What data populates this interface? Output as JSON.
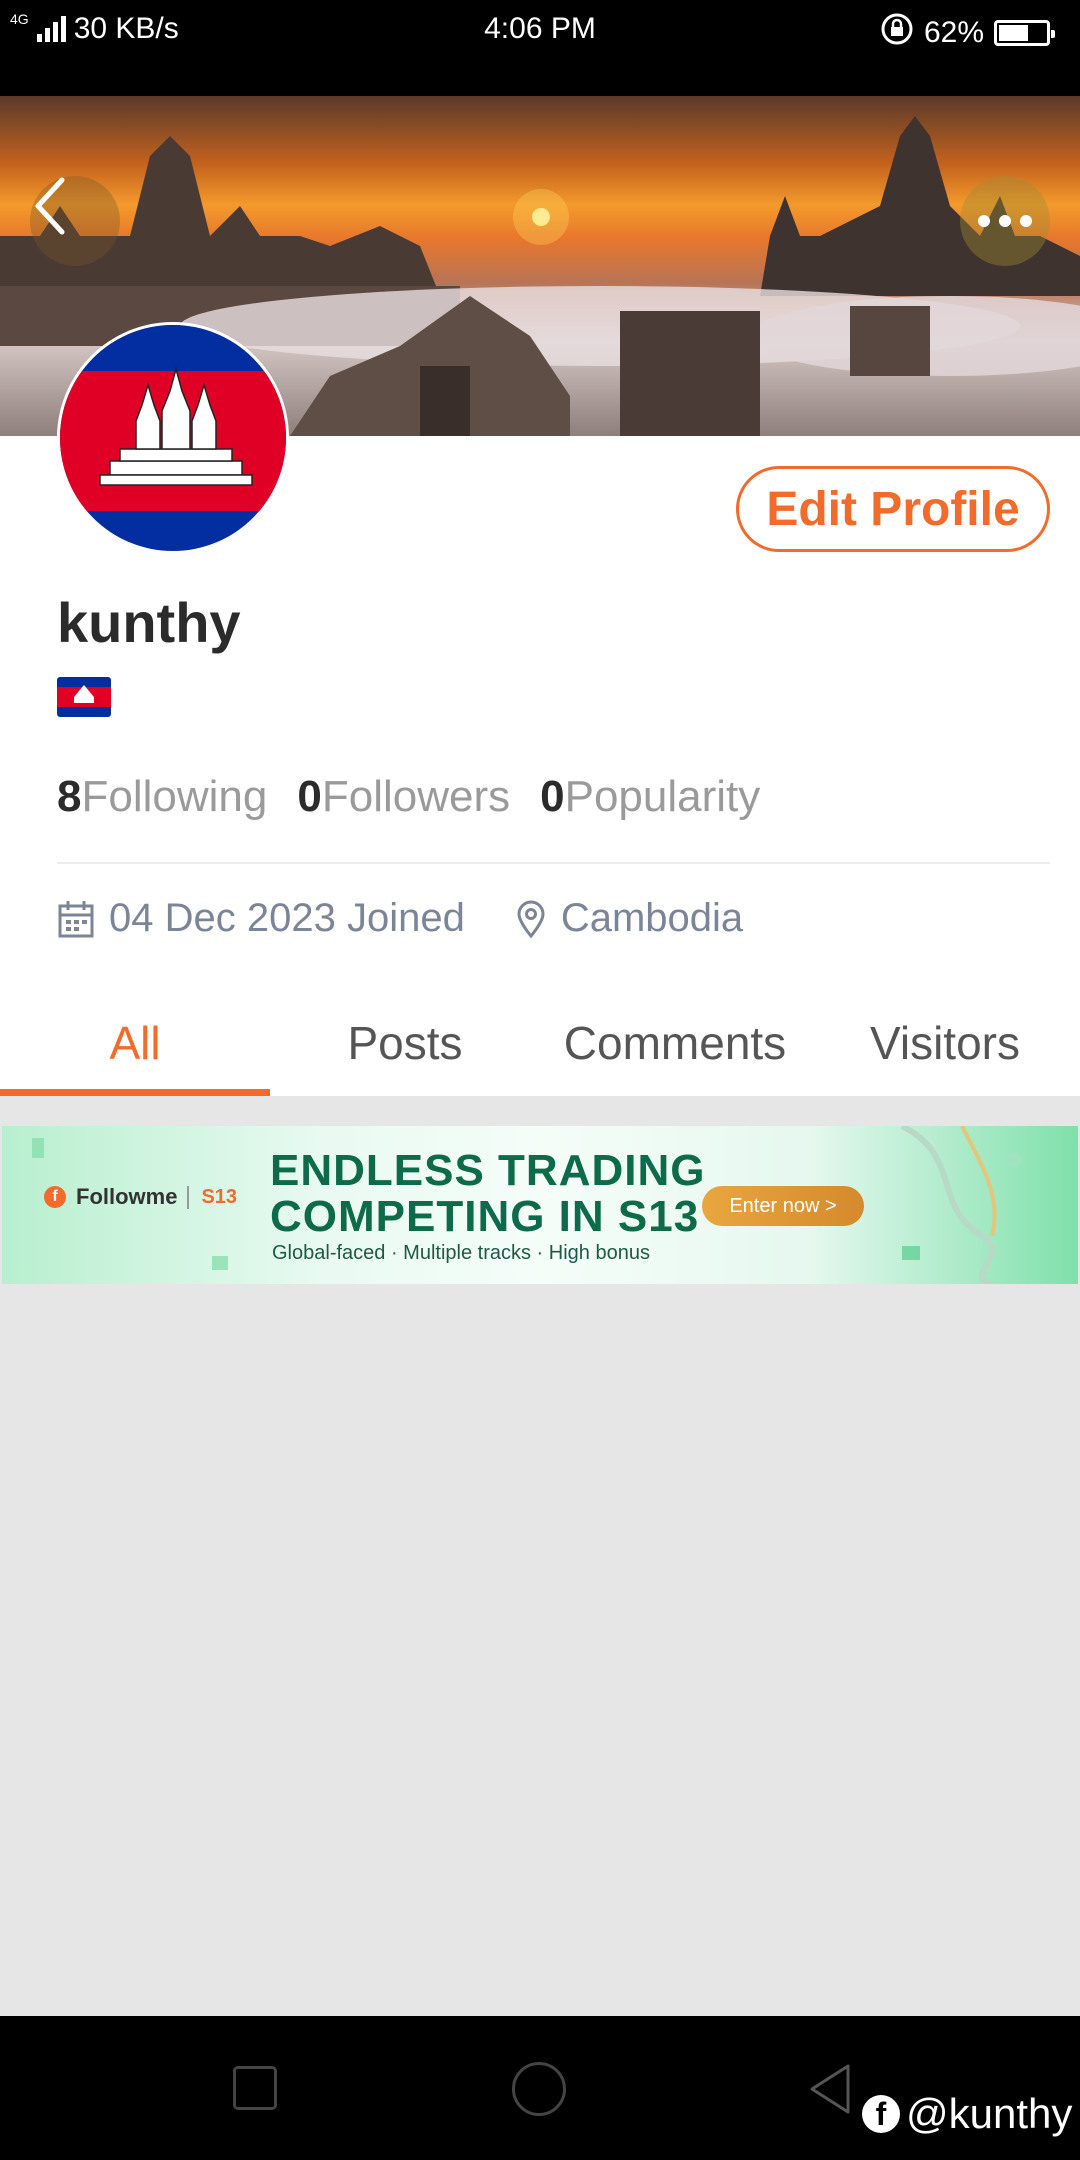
{
  "status_bar": {
    "network": "4G",
    "speed": "30 KB/s",
    "time": "4:06 PM",
    "battery_percent": "62%",
    "battery_level": 0.62
  },
  "header": {
    "back_icon": "chevron-left-icon",
    "more_icon": "more-dots-icon"
  },
  "profile": {
    "username": "kunthy",
    "edit_label": "Edit Profile",
    "stats": [
      {
        "num": "8",
        "label": "Following"
      },
      {
        "num": "0",
        "label": "Followers"
      },
      {
        "num": "0",
        "label": "Popularity"
      }
    ],
    "joined": "04 Dec 2023 Joined",
    "location": "Cambodia"
  },
  "tabs": [
    {
      "label": "All",
      "active": true
    },
    {
      "label": "Posts",
      "active": false
    },
    {
      "label": "Comments",
      "active": false
    },
    {
      "label": "Visitors",
      "active": false
    }
  ],
  "banner": {
    "brand": "Followme",
    "season": "S13",
    "headline_1": "ENDLESS TRADING",
    "headline_2": "COMPETING IN S13",
    "subline": "Global-faced · Multiple tracks · High bonus",
    "cta": "Enter now >"
  },
  "watermark": {
    "handle": "@kunthy"
  },
  "colors": {
    "accent": "#f26b2b",
    "flag_blue": "#032ea1",
    "flag_red": "#e00025"
  }
}
